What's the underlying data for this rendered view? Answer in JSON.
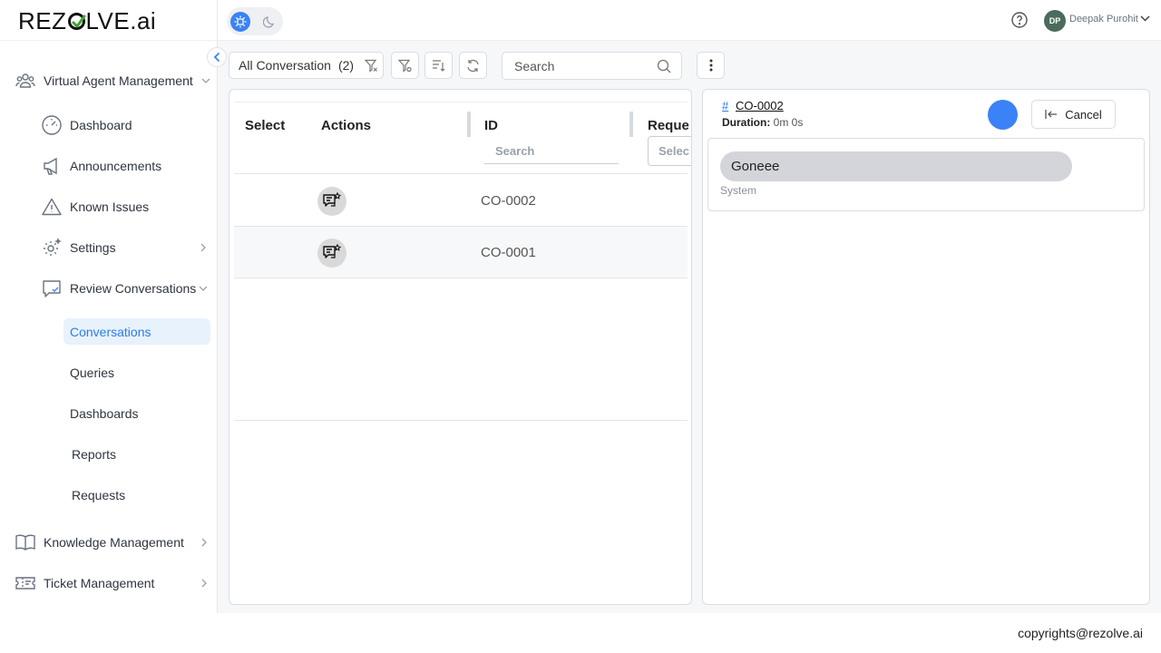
{
  "app": {
    "logo_text_1": "REZ",
    "logo_text_2": "LVE.ai"
  },
  "topbar": {
    "user_initials": "DP",
    "user_name": "Deepak Purohit"
  },
  "sidebar": {
    "groups": [
      {
        "label": "Virtual Agent Management"
      },
      {
        "label": "Knowledge Management"
      },
      {
        "label": "Ticket Management"
      }
    ],
    "items": [
      {
        "label": "Dashboard"
      },
      {
        "label": "Announcements"
      },
      {
        "label": "Known Issues"
      },
      {
        "label": "Settings"
      },
      {
        "label": "Review Conversations"
      }
    ],
    "sub_items": [
      {
        "label": "Conversations",
        "active": true
      },
      {
        "label": "Queries"
      },
      {
        "label": "Dashboards"
      },
      {
        "label": "Reports"
      },
      {
        "label": "Requests"
      }
    ]
  },
  "toolbar": {
    "view_label": "All Conversation",
    "view_count": "(2)",
    "search_placeholder": "Search"
  },
  "grid": {
    "columns": [
      {
        "label": "Select"
      },
      {
        "label": "Actions"
      },
      {
        "label": "ID",
        "filter_placeholder": "Search"
      },
      {
        "label": "Reque",
        "filter_placeholder": "Selec"
      }
    ],
    "rows": [
      {
        "id": "CO-0002"
      },
      {
        "id": "CO-0001"
      }
    ]
  },
  "detail": {
    "hash": "#",
    "id": "CO-0002",
    "duration_label": "Duration:",
    "duration_value": "0m 0s",
    "cancel_label": "Cancel",
    "messages": [
      {
        "text": "Goneee",
        "sender": "System"
      }
    ]
  },
  "footer": {
    "copyright": "copyrights@rezolve.ai"
  },
  "colors": {
    "accent": "#3b82f6",
    "active_bg": "#e8f2fd",
    "active_text": "#2b7de9"
  }
}
